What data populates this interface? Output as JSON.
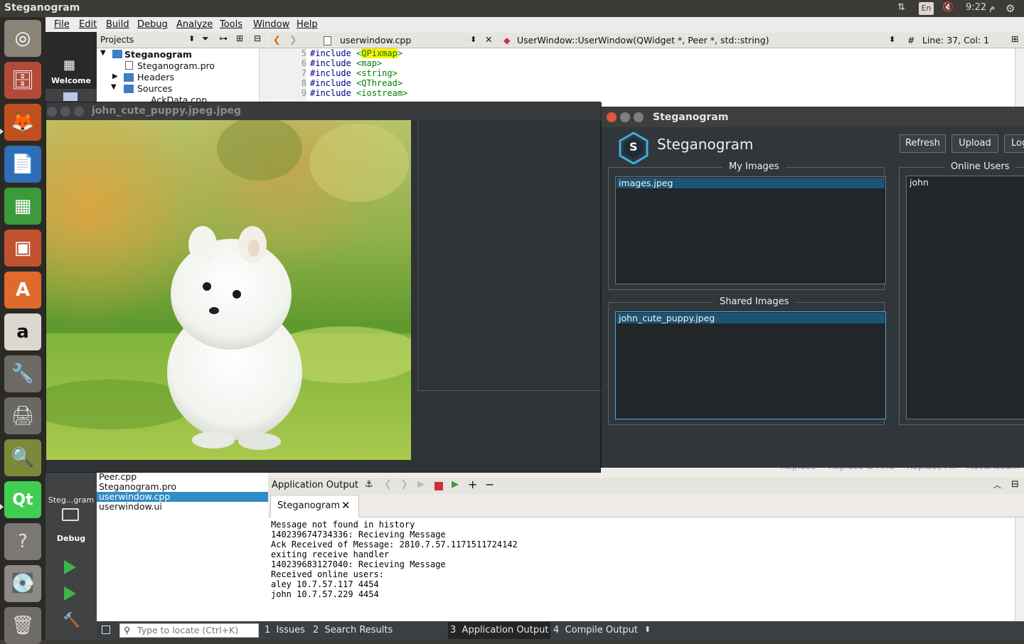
{
  "top_panel": {
    "title": "Steganogram",
    "lang": "En",
    "clock": "9:22 م"
  },
  "launcher": {
    "items": [
      "ubuntu-dash",
      "files",
      "firefox",
      "writer",
      "calc",
      "impress",
      "software-center",
      "amazon",
      "system-settings",
      "scanner",
      "image-viewer",
      "qt-creator",
      "help",
      "drive",
      "trash"
    ]
  },
  "qt_creator": {
    "menu": [
      "File",
      "Edit",
      "Build",
      "Debug",
      "Analyze",
      "Tools",
      "Window",
      "Help"
    ],
    "mode_welcome": "Welcome",
    "kit_label": "Steg...gram",
    "kit_mode": "Debug",
    "projects_label": "Projects",
    "project_tree": {
      "root": "Steganogram",
      "pro": "Steganogram.pro",
      "headers": "Headers",
      "sources": "Sources",
      "partial": "AckData.cpp"
    },
    "editor_tab": "userwindow.cpp",
    "symbol": "UserWindow::UserWindow(QWidget *, Peer *, std::string)",
    "hash": "#",
    "cursor_pos": "Line: 37, Col: 1",
    "lines": [
      {
        "n": "5",
        "text": "#include <QPixmap>"
      },
      {
        "n": "6",
        "text": "#include <map>"
      },
      {
        "n": "7",
        "text": "#include <string>"
      },
      {
        "n": "8",
        "text": "#include <QThread>"
      },
      {
        "n": "9",
        "text": "#include <iostream>"
      }
    ],
    "find_bar_partial": [
      "Replace",
      "Replace & Find",
      "Replace All",
      "Advanced..."
    ],
    "open_files": [
      "Peer.cpp",
      "Steganogram.pro",
      "userwindow.cpp",
      "userwindow.ui"
    ],
    "output_title": "Application Output",
    "output_tab": "Steganogram",
    "output_lines": [
      "Message not found in history",
      "140239674734336: Recieving Message",
      "Ack Received of Message: 2810.7.57.1171511724142",
      "exiting receive handler",
      "140239683127040: Recieving Message",
      "Received online users:",
      "aley 10.7.57.117 4454",
      "john 10.7.57.229 4454"
    ],
    "locate_placeholder": "Type to locate (Ctrl+K)",
    "status_tabs": [
      {
        "num": "1",
        "label": "Issues"
      },
      {
        "num": "2",
        "label": "Search Results"
      },
      {
        "num": "3",
        "label": "Application Output"
      },
      {
        "num": "4",
        "label": "Compile Output"
      }
    ]
  },
  "image_window": {
    "title": "john_cute_puppy.jpeg.jpeg"
  },
  "steg_window": {
    "title": "Steganogram",
    "app_name": "Steganogram",
    "logo_letter": "S",
    "refresh": "Refresh",
    "upload": "Upload",
    "logout_partial": "Log",
    "my_images_title": "My Images",
    "my_images": [
      "images.jpeg"
    ],
    "shared_images_title": "Shared Images",
    "shared_images": [
      "john_cute_puppy.jpeg"
    ],
    "online_users_title": "Online Users",
    "online_users": [
      "john"
    ]
  },
  "colors": {
    "dark_window_bg": "#31363b",
    "selection_blue": "#1d5373",
    "qt_selection": "#308cc6",
    "qt_green": "#41cd52"
  }
}
